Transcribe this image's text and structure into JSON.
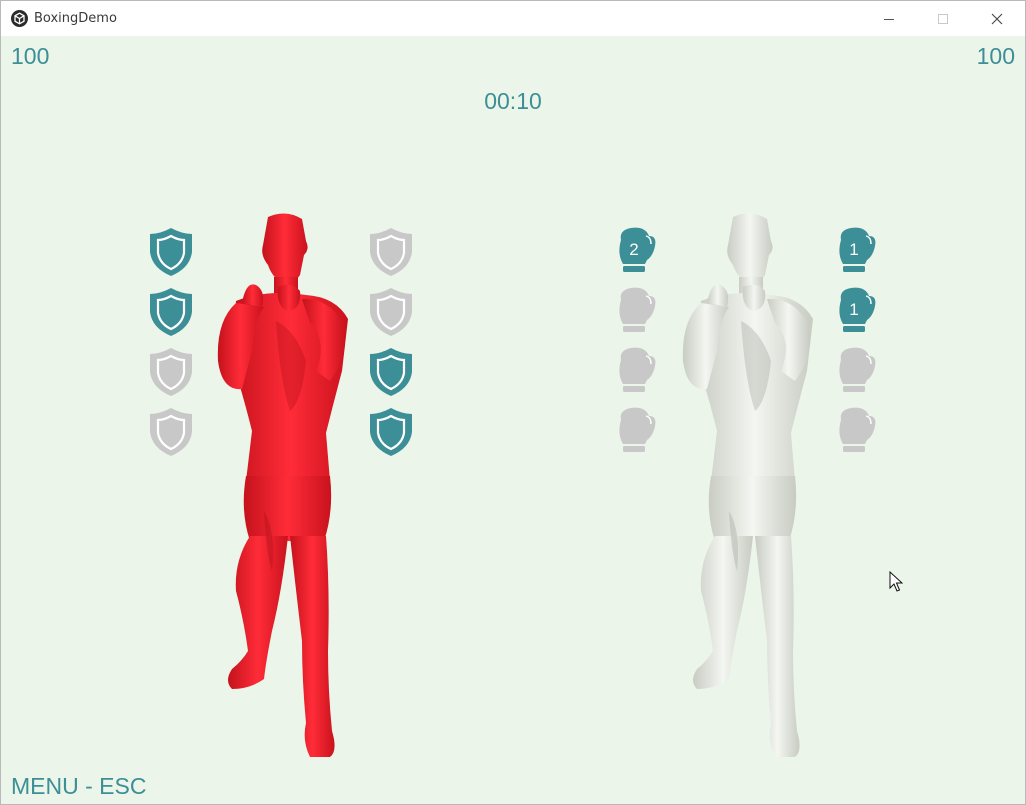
{
  "window": {
    "title": "BoxingDemo",
    "controls": [
      "minimize-icon",
      "maximize-icon",
      "close-icon"
    ]
  },
  "hud": {
    "score_left": "100",
    "score_right": "100",
    "timer": "00:10",
    "menu_hint": "MENU - ESC"
  },
  "colors": {
    "accent": "#3d8f97",
    "inactive": "#c8c8c8",
    "background": "#ecf5e9",
    "player_red": "#e8232e",
    "player_white": "#e3e6df"
  },
  "player_left": {
    "color": "red",
    "shields_left_column": [
      {
        "icon": "shield-icon",
        "active": true
      },
      {
        "icon": "shield-icon",
        "active": true
      },
      {
        "icon": "shield-icon",
        "active": false
      },
      {
        "icon": "shield-icon",
        "active": false
      }
    ],
    "shields_right_column": [
      {
        "icon": "shield-icon",
        "active": false
      },
      {
        "icon": "shield-icon",
        "active": false
      },
      {
        "icon": "shield-icon",
        "active": true
      },
      {
        "icon": "shield-icon",
        "active": true
      }
    ]
  },
  "player_right": {
    "color": "white",
    "gloves_left_column": [
      {
        "icon": "glove-icon",
        "active": true,
        "count": "2"
      },
      {
        "icon": "glove-icon",
        "active": false,
        "count": ""
      },
      {
        "icon": "glove-icon",
        "active": false,
        "count": ""
      },
      {
        "icon": "glove-icon",
        "active": false,
        "count": ""
      }
    ],
    "gloves_right_column": [
      {
        "icon": "glove-icon",
        "active": true,
        "count": "1"
      },
      {
        "icon": "glove-icon",
        "active": true,
        "count": "1"
      },
      {
        "icon": "glove-icon",
        "active": false,
        "count": ""
      },
      {
        "icon": "glove-icon",
        "active": false,
        "count": ""
      }
    ]
  }
}
